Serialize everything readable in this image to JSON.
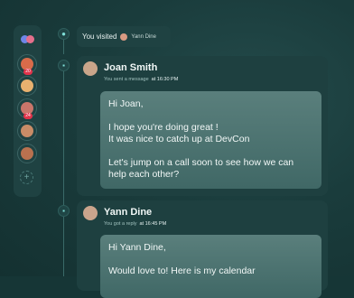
{
  "rail": {
    "avatars": [
      {
        "badge": "20",
        "color": "#d86b4a"
      },
      {
        "badge": "",
        "color": "#e8b16f"
      },
      {
        "badge": "24",
        "color": "#c9756a"
      },
      {
        "badge": "",
        "color": "#c98c67"
      },
      {
        "badge": "",
        "color": "#b9714f"
      }
    ]
  },
  "visited": {
    "label": "You visited",
    "name": "Yann Dine"
  },
  "messages": [
    {
      "name": "Joan Smith",
      "action": "You sent a message",
      "time": "at 16:30 PM",
      "lines": [
        "Hi Joan,",
        "I hope you're doing great !",
        "It was nice to catch up at DevCon",
        "Let's jump on a call soon to see how we can",
        "help each other?"
      ]
    },
    {
      "name": "Yann Dine",
      "action": "You got a reply",
      "time": "at 16:45 PM",
      "lines": [
        "Hi Yann Dine,",
        "Would love to! Here is my calendar"
      ]
    }
  ],
  "colors": {
    "accent": "#7fe0d8",
    "badge": "#e0334a"
  }
}
